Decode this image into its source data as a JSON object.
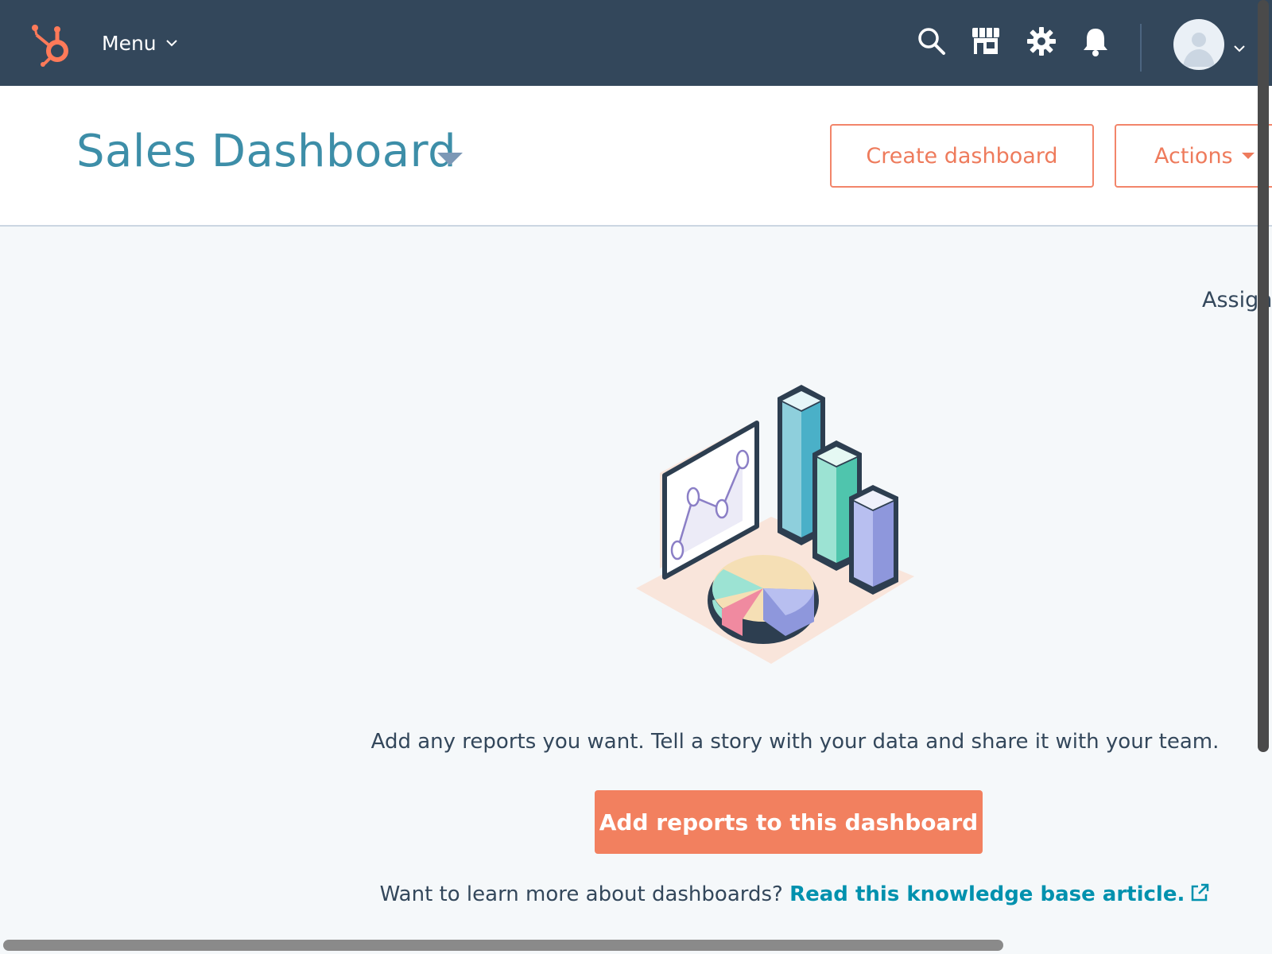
{
  "topnav": {
    "menu_label": "Menu",
    "icons": [
      "hubspot-logo",
      "search-icon",
      "marketplace-icon",
      "gear-icon",
      "bell-icon",
      "avatar",
      "chevron-down-icon"
    ],
    "background": "#33475b",
    "logo_color": "#ff7a59"
  },
  "header": {
    "title": "Sales Dashboard",
    "create_button": "Create dashboard",
    "actions_button": "Actions",
    "title_color": "#3d8ea8",
    "accent": "#ff7a59"
  },
  "main": {
    "side_label": "Assign",
    "tagline": "Add any reports you want. Tell a story with your data and share it with your team.",
    "primary_button": "Add reports to this dashboard",
    "learn_prefix": "Want to learn more about dashboards?",
    "learn_link": "Read this knowledge base article.",
    "link_icon": "external-link-icon"
  }
}
